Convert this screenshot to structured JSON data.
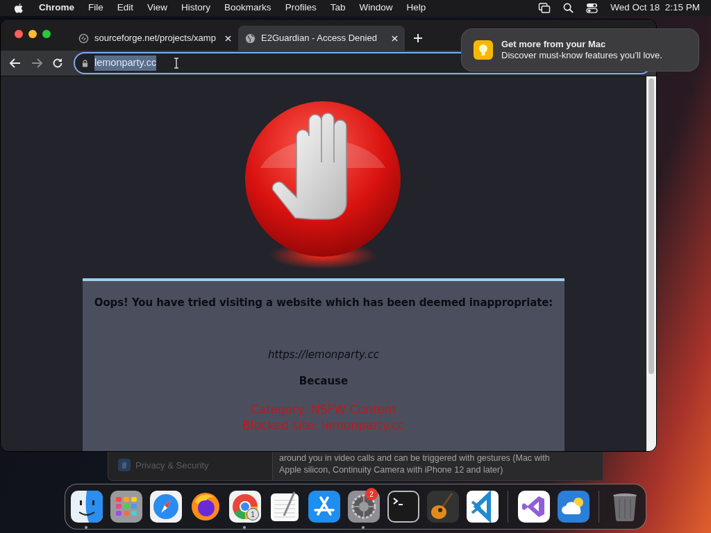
{
  "menu_bar": {
    "app": "Chrome",
    "menus": [
      "File",
      "Edit",
      "View",
      "History",
      "Bookmarks",
      "Profiles",
      "Tab",
      "Window",
      "Help"
    ],
    "clock": "Wed Oct 18  2:15 PM"
  },
  "browser": {
    "tabs": [
      {
        "title": "sourceforge.net/projects/xamp",
        "kind": "sourceforge",
        "selected": false
      },
      {
        "title": "E2Guardian - Access Denied",
        "kind": "globe",
        "selected": true
      }
    ],
    "address": {
      "value": "lemonparty.cc",
      "text_selected": true
    },
    "page": {
      "heading": "Oops! You have tried visiting a website which has been deemed inappropriate:",
      "url": "https://lemonparty.cc",
      "because": "Because",
      "reasons": [
        "Category: NSFW Content",
        "Blocked site: lemonparty.cc"
      ]
    }
  },
  "notification": {
    "title": "Get more from your Mac",
    "body": "Discover must-know features you’ll love."
  },
  "background_window": {
    "sidebar_item": "Privacy & Security",
    "lines": [
      "around you in video calls and can be triggered with gestures (Mac with",
      "Apple silicon, Continuity Camera with iPhone 12 and later)"
    ]
  },
  "dock": [
    {
      "kind": "finder",
      "running": true
    },
    {
      "kind": "launchpad",
      "running": false
    },
    {
      "kind": "safari",
      "running": false
    },
    {
      "kind": "firefox",
      "running": false
    },
    {
      "kind": "chrome",
      "running": true,
      "badge": "1"
    },
    {
      "kind": "textedit",
      "running": false
    },
    {
      "kind": "appstore",
      "running": false
    },
    {
      "kind": "settings",
      "running": true,
      "badge": "2"
    },
    {
      "kind": "terminal",
      "running": false
    },
    {
      "kind": "garageband",
      "running": false
    },
    {
      "kind": "vscode",
      "running": false
    },
    {
      "kind": "divider"
    },
    {
      "kind": "visualstudio",
      "running": false
    },
    {
      "kind": "weather",
      "running": false
    },
    {
      "kind": "divider"
    },
    {
      "kind": "trash",
      "running": false
    }
  ]
}
